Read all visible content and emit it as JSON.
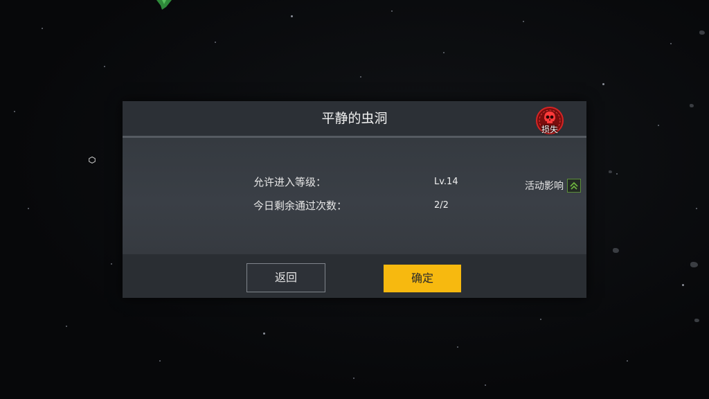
{
  "dialog": {
    "title": "平静的虫洞",
    "loss_badge": {
      "label": "损失",
      "icon": "skull-icon",
      "color": "#c41a1a"
    },
    "activity": {
      "label": "活动影响",
      "icon": "chevron-up-double-icon",
      "color": "#6db33f"
    },
    "rows": [
      {
        "label": "允许进入等级：",
        "value": "Lv.14"
      },
      {
        "label": "今日剩余通过次数：",
        "value": "2/2"
      }
    ],
    "buttons": {
      "back": "返回",
      "confirm": "确定"
    }
  },
  "colors": {
    "confirm_button": "#f7b90f",
    "dialog_background": "#2f3339",
    "space_background": "#07080a"
  }
}
